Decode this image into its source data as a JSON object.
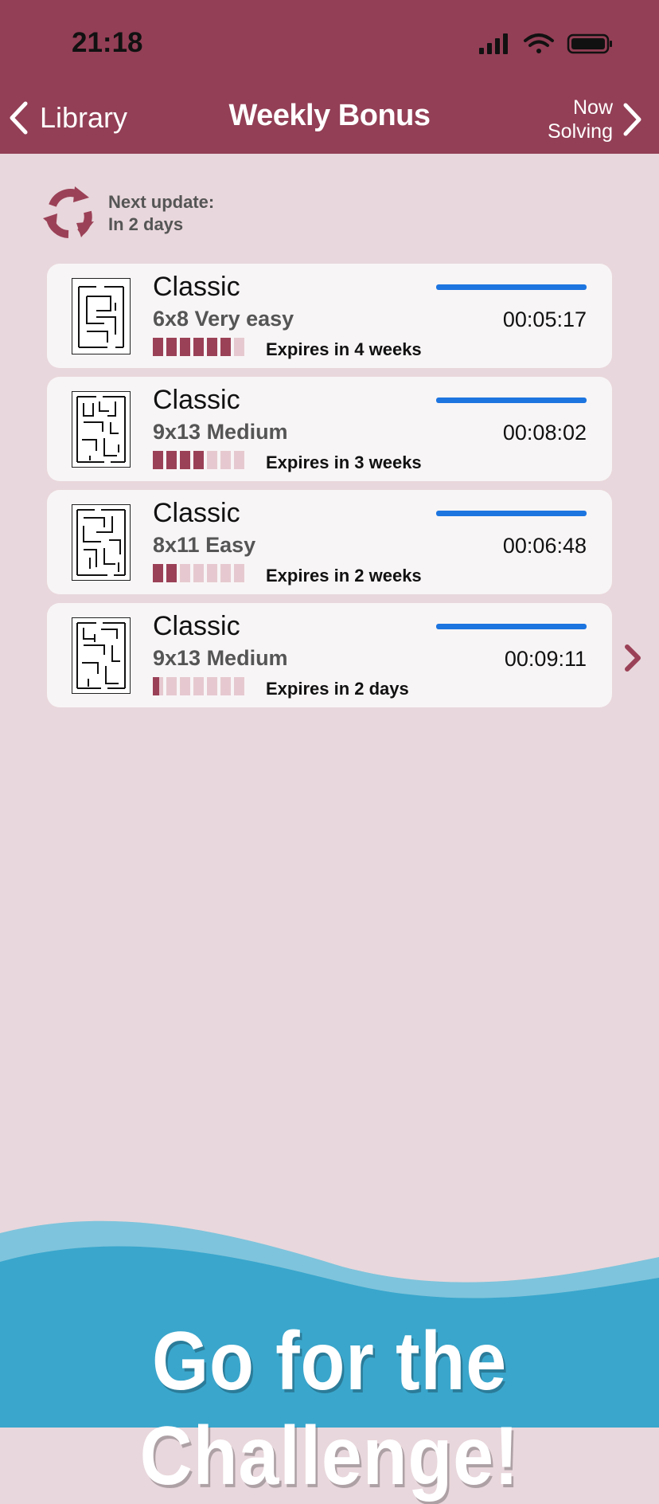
{
  "status_bar": {
    "time": "21:18",
    "icons": [
      "signal-icon",
      "wifi-icon",
      "battery-icon"
    ]
  },
  "nav": {
    "back_label": "Library",
    "title": "Weekly Bonus",
    "right_line1": "Now",
    "right_line2": "Solving"
  },
  "update": {
    "line1": "Next update:",
    "line2": "In 2 days"
  },
  "puzzles": [
    {
      "title": "Classic",
      "subtitle": "6x8 Very easy",
      "time": "00:05:17",
      "expires": "Expires in 4 weeks",
      "segments_filled": 6,
      "segments_total": 7
    },
    {
      "title": "Classic",
      "subtitle": "9x13 Medium",
      "time": "00:08:02",
      "expires": "Expires in 3 weeks",
      "segments_filled": 4,
      "segments_total": 7
    },
    {
      "title": "Classic",
      "subtitle": "8x11 Easy",
      "time": "00:06:48",
      "expires": "Expires in 2 weeks",
      "segments_filled": 2,
      "segments_total": 7
    },
    {
      "title": "Classic",
      "subtitle": "9x13 Medium",
      "time": "00:09:11",
      "expires": "Expires in 2 days",
      "segments_filled": 0.5,
      "segments_total": 7
    }
  ],
  "banner": {
    "text": "Go for the Challenge!"
  },
  "colors": {
    "header": "#933f56",
    "background": "#e8d7dc",
    "progress": "#1d75e0",
    "segment_on": "#9b4157",
    "segment_off": "#e6c9d0",
    "wave": "#3aa6cc"
  }
}
